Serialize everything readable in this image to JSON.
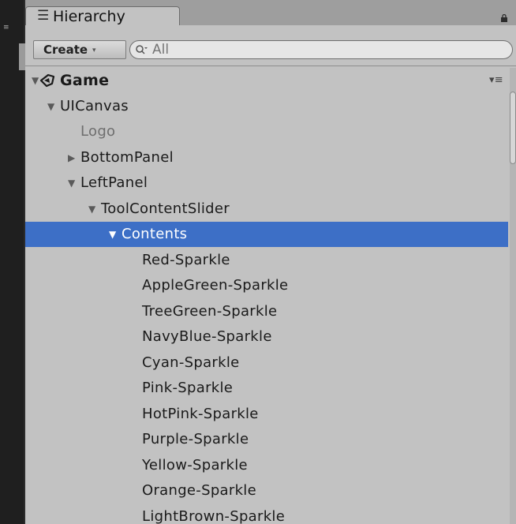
{
  "window": {
    "tab_icon": "hierarchy-list-icon",
    "tab_label": "Hierarchy",
    "lock_icon": "lock-icon"
  },
  "toolbar": {
    "create_label": "Create",
    "create_chevron": "▾",
    "search_placeholder": "All",
    "search_value": ""
  },
  "colors": {
    "panel_bg": "#c2c2c2",
    "selection": "#3d6fc6",
    "tab_bar": "#9e9e9e"
  },
  "scene": {
    "name": "Game",
    "icon": "unity-logo-icon",
    "menu_glyph": "▾≡"
  },
  "tree": [
    {
      "label": "UICanvas",
      "expanded": true,
      "has_children": true,
      "depth": 1
    },
    {
      "label": "Logo",
      "has_children": false,
      "depth": 2,
      "disabled": true
    },
    {
      "label": "BottomPanel",
      "expanded": false,
      "has_children": true,
      "depth": 2
    },
    {
      "label": "LeftPanel",
      "expanded": true,
      "has_children": true,
      "depth": 2
    },
    {
      "label": "ToolContentSlider",
      "expanded": true,
      "has_children": true,
      "depth": 3
    },
    {
      "label": "Contents",
      "expanded": true,
      "has_children": true,
      "depth": 4,
      "selected": true
    },
    {
      "label": "Red-Sparkle",
      "has_children": false,
      "depth": 5
    },
    {
      "label": "AppleGreen-Sparkle",
      "has_children": false,
      "depth": 5
    },
    {
      "label": "TreeGreen-Sparkle",
      "has_children": false,
      "depth": 5
    },
    {
      "label": "NavyBlue-Sparkle",
      "has_children": false,
      "depth": 5
    },
    {
      "label": "Cyan-Sparkle",
      "has_children": false,
      "depth": 5
    },
    {
      "label": "Pink-Sparkle",
      "has_children": false,
      "depth": 5
    },
    {
      "label": "HotPink-Sparkle",
      "has_children": false,
      "depth": 5
    },
    {
      "label": "Purple-Sparkle",
      "has_children": false,
      "depth": 5
    },
    {
      "label": "Yellow-Sparkle",
      "has_children": false,
      "depth": 5
    },
    {
      "label": "Orange-Sparkle",
      "has_children": false,
      "depth": 5
    },
    {
      "label": "LightBrown-Sparkle",
      "has_children": false,
      "depth": 5
    }
  ]
}
